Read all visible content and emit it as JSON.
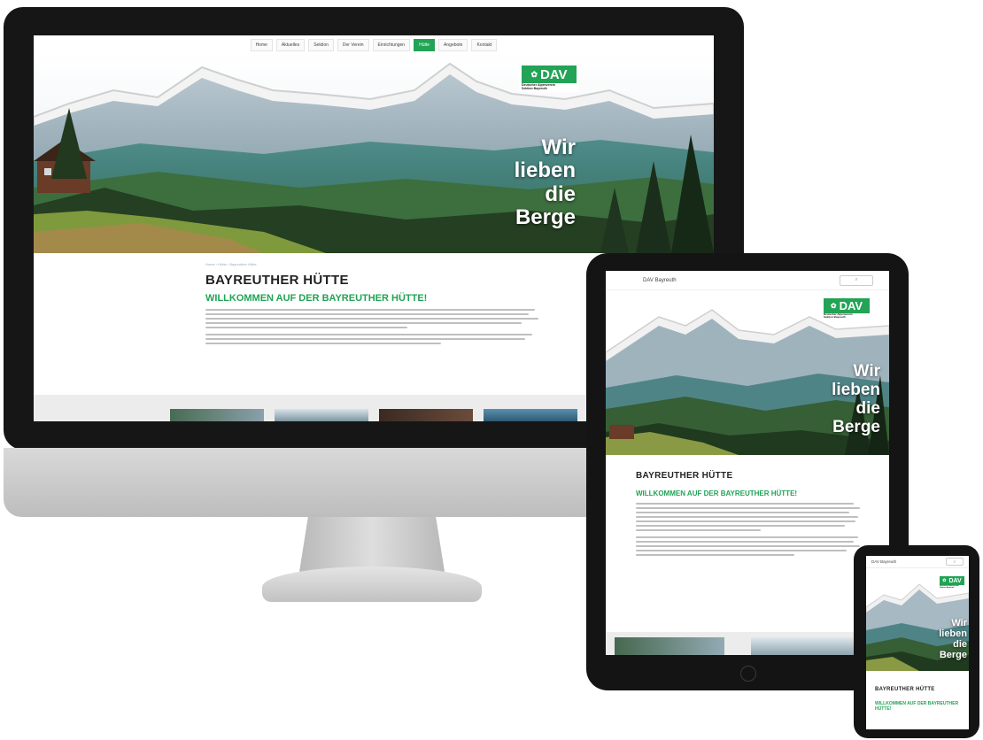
{
  "site": {
    "nav": [
      "Home",
      "Aktuelles",
      "Sektion",
      "Der Verein",
      "Einrichtungen",
      "Hütte",
      "Angebote",
      "Kontakt"
    ],
    "active_nav_index": 5,
    "breadcrumb": "Home  ›  Hütte  ›  Bayreuther Hütte",
    "logo_text": "DAV",
    "logo_sub_1": "Deutscher Alpenverein",
    "logo_sub_2": "Sektion Bayreuth",
    "slogan": [
      "Wir",
      "lieben",
      "die",
      "Berge"
    ],
    "page_title": "BAYREUTHER HÜTTE",
    "welcome": "WILLKOMMEN AUF DER BAYREUTHER HÜTTE!",
    "mobile_title": "DAV Bayreuth"
  },
  "colors": {
    "brand_green": "#22a356",
    "device_dark": "#141414",
    "device_silver": "#cfcfcf"
  }
}
